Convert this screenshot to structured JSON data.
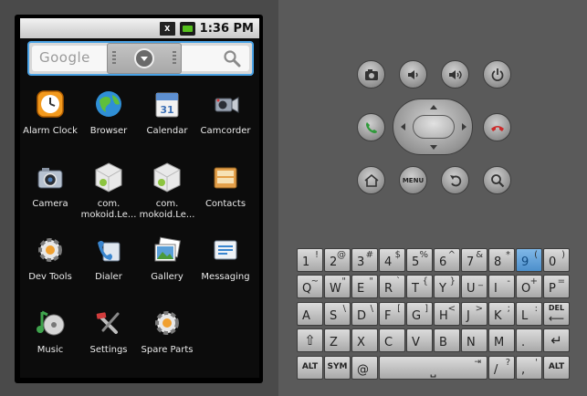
{
  "status_bar": {
    "signal_glyph": "X",
    "time": "1:36 PM"
  },
  "search": {
    "logo_text": "Google"
  },
  "apps": [
    {
      "label": "Alarm Clock",
      "icon": "alarm-clock-icon"
    },
    {
      "label": "Browser",
      "icon": "browser-globe-icon"
    },
    {
      "label": "Calendar",
      "icon": "calendar-icon"
    },
    {
      "label": "Camcorder",
      "icon": "camcorder-icon"
    },
    {
      "label": "Camera",
      "icon": "camera-icon"
    },
    {
      "label": "com.\nmokoid.Le...",
      "icon": "android-package-icon"
    },
    {
      "label": "com.\nmokoid.Le...",
      "icon": "android-package-icon"
    },
    {
      "label": "Contacts",
      "icon": "contacts-icon"
    },
    {
      "label": "Dev Tools",
      "icon": "gear-icon"
    },
    {
      "label": "Dialer",
      "icon": "dialer-phone-icon"
    },
    {
      "label": "Gallery",
      "icon": "gallery-icon"
    },
    {
      "label": "Messaging",
      "icon": "messaging-icon"
    },
    {
      "label": "Music",
      "icon": "music-icon"
    },
    {
      "label": "Settings",
      "icon": "settings-tools-icon"
    },
    {
      "label": "Spare Parts",
      "icon": "gear-icon"
    }
  ],
  "calendar_day": "31",
  "controls": {
    "menu_label": "MENU"
  },
  "keyboard": {
    "row1": [
      {
        "main": "1",
        "alt": "!"
      },
      {
        "main": "2",
        "alt": "@"
      },
      {
        "main": "3",
        "alt": "#"
      },
      {
        "main": "4",
        "alt": "$"
      },
      {
        "main": "5",
        "alt": "%"
      },
      {
        "main": "6",
        "alt": "^"
      },
      {
        "main": "7",
        "alt": "&"
      },
      {
        "main": "8",
        "alt": "*"
      },
      {
        "main": "9",
        "alt": "("
      },
      {
        "main": "0",
        "alt": ")"
      }
    ],
    "row2": [
      {
        "main": "Q",
        "alt": "~"
      },
      {
        "main": "W",
        "alt": "\""
      },
      {
        "main": "E",
        "alt": "\""
      },
      {
        "main": "R",
        "alt": "`"
      },
      {
        "main": "T",
        "alt": "{"
      },
      {
        "main": "Y",
        "alt": "}"
      },
      {
        "main": "U",
        "alt": "_"
      },
      {
        "main": "I",
        "alt": "-"
      },
      {
        "main": "O",
        "alt": "+"
      },
      {
        "main": "P",
        "alt": "="
      }
    ],
    "row3": [
      {
        "main": "A",
        "alt": ""
      },
      {
        "main": "S",
        "alt": "\\"
      },
      {
        "main": "D",
        "alt": "\\"
      },
      {
        "main": "F",
        "alt": "["
      },
      {
        "main": "G",
        "alt": "]"
      },
      {
        "main": "H",
        "alt": "<"
      },
      {
        "main": "J",
        "alt": ">"
      },
      {
        "main": "K",
        "alt": ";"
      },
      {
        "main": "L",
        "alt": ":"
      }
    ],
    "del_label": "DEL",
    "row4": [
      {
        "main": "Z",
        "alt": ""
      },
      {
        "main": "X",
        "alt": ""
      },
      {
        "main": "C",
        "alt": ""
      },
      {
        "main": "V",
        "alt": ""
      },
      {
        "main": "B",
        "alt": ""
      },
      {
        "main": "N",
        "alt": ""
      },
      {
        "main": "M",
        "alt": ""
      },
      {
        "main": ".",
        "alt": ""
      }
    ],
    "alt_label": "ALT",
    "sym_label": "SYM",
    "at_label": "@",
    "slash_label": "/",
    "slash_alt": "?",
    "comma_label": ",",
    "comma_alt": "'",
    "highlight_key": "9"
  }
}
